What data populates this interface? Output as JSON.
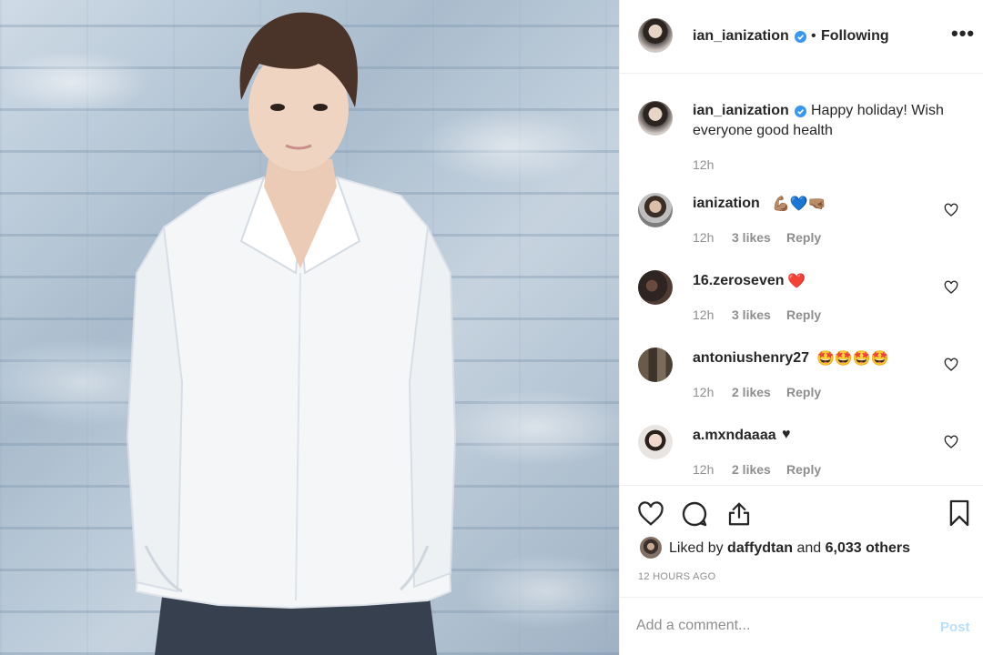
{
  "post": {
    "author": "ian_ianization",
    "follow_status": "Following",
    "separator": "•",
    "more_label": "•••",
    "caption": {
      "username": "ian_ianization",
      "text_line1": "Happy holiday! Wish",
      "text_line2": "everyone good health",
      "time": "12h"
    },
    "comments": [
      {
        "username": "ianization",
        "text": "💪🏽💙🤜🏽",
        "time": "12h",
        "likes": "3 likes",
        "reply": "Reply"
      },
      {
        "username": "16.zeroseven",
        "text": "❤️",
        "time": "12h",
        "likes": "3 likes",
        "reply": "Reply"
      },
      {
        "username": "antoniushenry27",
        "text": "🤩🤩🤩🤩",
        "time": "12h",
        "likes": "2 likes",
        "reply": "Reply"
      },
      {
        "username": "a.mxndaaaa",
        "text": "♥",
        "time": "12h",
        "likes": "2 likes",
        "reply": "Reply"
      }
    ],
    "liked_by_prefix": "Liked by",
    "liked_by_user": "daffydtan",
    "liked_by_conj": "and",
    "liked_by_others": "6,033 others",
    "posted_ago": "12 HOURS AGO"
  },
  "comment_box": {
    "placeholder": "Add a comment...",
    "post_label": "Post"
  },
  "colors": {
    "verified": "#3897f0",
    "post_disabled": "#b9dffc",
    "muted": "#8e8e8e"
  },
  "icons": [
    "heart-icon",
    "comment-icon",
    "share-icon",
    "bookmark-icon",
    "verified-icon",
    "more-icon"
  ]
}
